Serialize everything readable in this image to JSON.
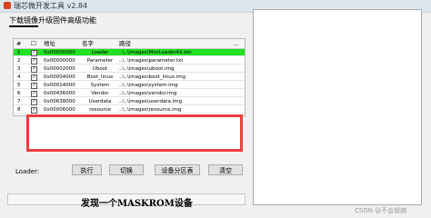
{
  "window": {
    "title": "瑞芯微开发工具 v2.84"
  },
  "tabs": [
    "下载镜像",
    "升级固件",
    "高级功能"
  ],
  "table": {
    "headers": [
      "#",
      "☐",
      "地址",
      "名字",
      "路径",
      "..."
    ],
    "rows": [
      {
        "n": "1",
        "checked": true,
        "addr": "0x00000000",
        "name": "Loader",
        "path": "..\\..\\images\\MiniLoaderAll.bin",
        "selected": true
      },
      {
        "n": "2",
        "checked": true,
        "addr": "0x00000000",
        "name": "Parameter",
        "path": "..\\..\\images\\parameter.txt",
        "selected": false
      },
      {
        "n": "3",
        "checked": true,
        "addr": "0x00002000",
        "name": "Uboot",
        "path": "..\\..\\images\\uboot.img",
        "selected": false
      },
      {
        "n": "4",
        "checked": true,
        "addr": "0x00004000",
        "name": "Boot_linux",
        "path": "..\\..\\images\\boot_linux.img",
        "selected": false
      },
      {
        "n": "5",
        "checked": true,
        "addr": "0x00014000",
        "name": "System",
        "path": "..\\..\\images\\system.img",
        "selected": false
      },
      {
        "n": "6",
        "checked": true,
        "addr": "0x00436000",
        "name": "Vendor",
        "path": "..\\..\\images\\vendor.img",
        "selected": false
      },
      {
        "n": "7",
        "checked": true,
        "addr": "0x00638000",
        "name": "Userdata",
        "path": "..\\..\\images\\userdata.img",
        "selected": false
      },
      {
        "n": "8",
        "checked": true,
        "addr": "0x00006000",
        "name": "resource",
        "path": "..\\..\\images\\resource.img",
        "selected": false
      }
    ]
  },
  "loader_label": "Loader:",
  "buttons": {
    "execute": "执行",
    "switch": "切换",
    "partition": "设备分区表",
    "clear": "清空"
  },
  "status": "发现一个MASKROM设备",
  "watermark": "CSDN @不会就搞"
}
